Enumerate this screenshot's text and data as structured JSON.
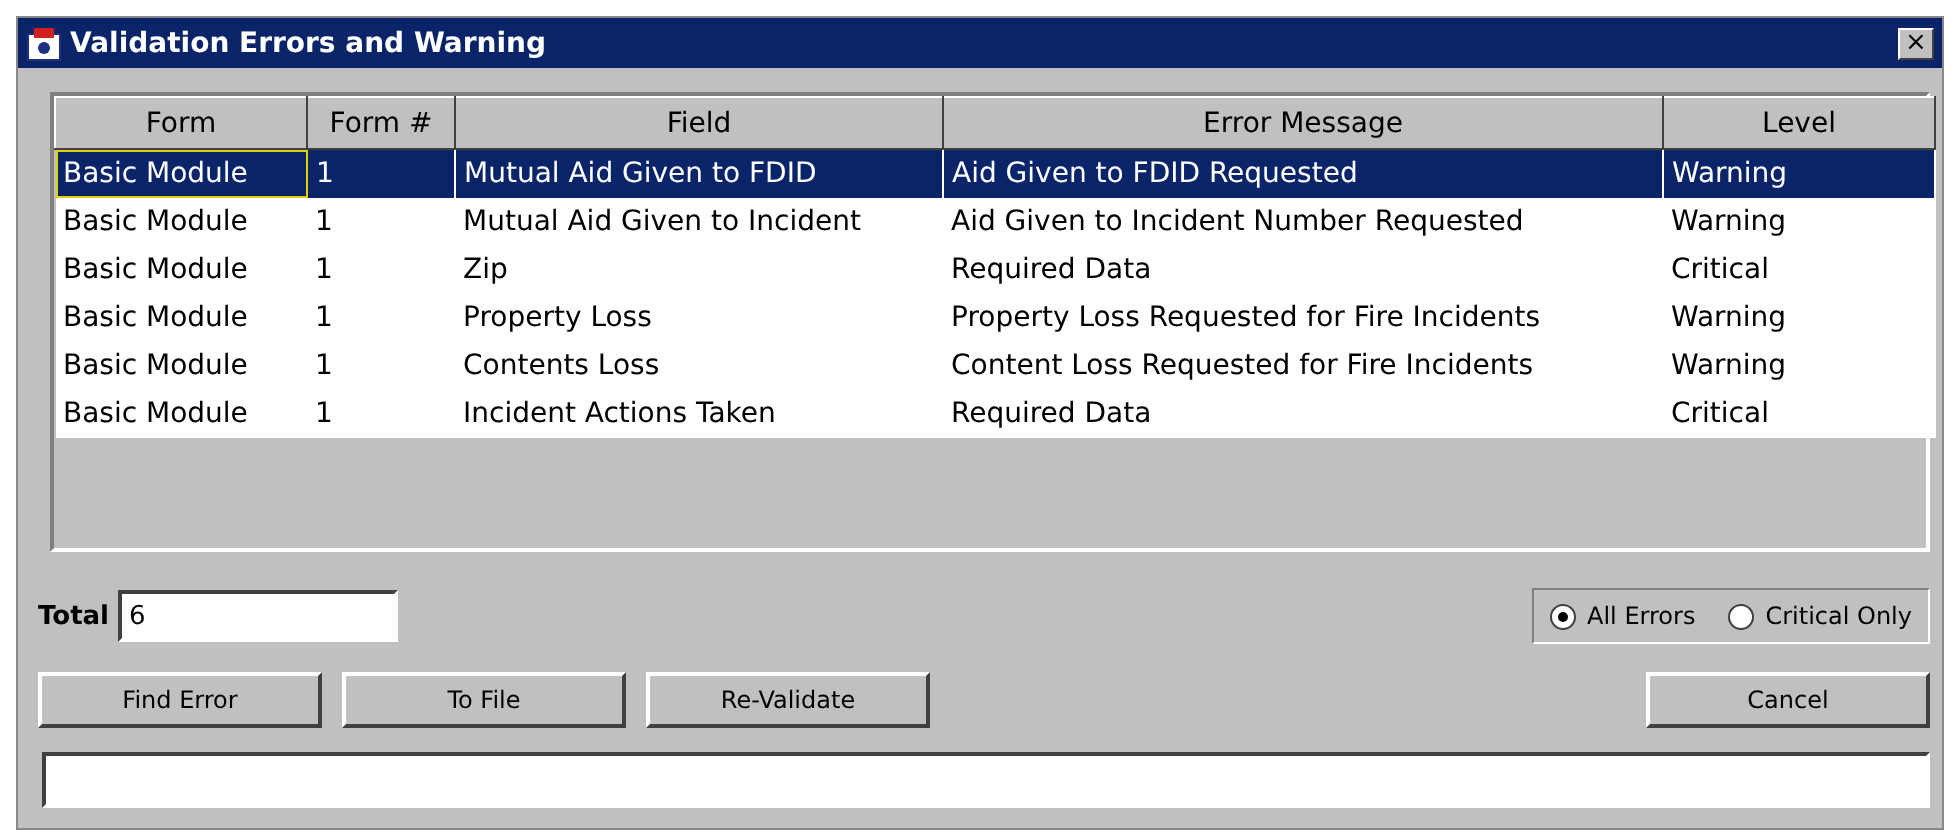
{
  "window": {
    "title": "Validation Errors and Warning",
    "close": "×"
  },
  "table": {
    "columns": [
      "Form",
      "Form #",
      "Field",
      "Error Message",
      "Level"
    ],
    "rows": [
      {
        "cells": [
          "Basic Module",
          "1",
          "Mutual Aid Given to FDID",
          "Aid Given to FDID Requested",
          "Warning"
        ],
        "selected": true
      },
      {
        "cells": [
          "Basic Module",
          "1",
          "Mutual Aid Given to Incident",
          "Aid Given to Incident Number Requested",
          "Warning"
        ],
        "selected": false
      },
      {
        "cells": [
          "Basic Module",
          "1",
          "Zip",
          "Required Data",
          "Critical"
        ],
        "selected": false
      },
      {
        "cells": [
          "Basic Module",
          "1",
          "Property Loss",
          "Property Loss Requested for Fire Incidents",
          "Warning"
        ],
        "selected": false
      },
      {
        "cells": [
          "Basic Module",
          "1",
          "Contents Loss",
          "Content Loss Requested for Fire Incidents",
          "Warning"
        ],
        "selected": false
      },
      {
        "cells": [
          "Basic Module",
          "1",
          "Incident Actions Taken",
          "Required Data",
          "Critical"
        ],
        "selected": false
      }
    ]
  },
  "total": {
    "label": "Total",
    "value": "6"
  },
  "filter": [
    {
      "label": "All Errors",
      "selected": true
    },
    {
      "label": "Critical Only",
      "selected": false
    }
  ],
  "buttons": [
    "Find Error",
    "To File",
    "Re-Validate"
  ],
  "cancel": "Cancel"
}
